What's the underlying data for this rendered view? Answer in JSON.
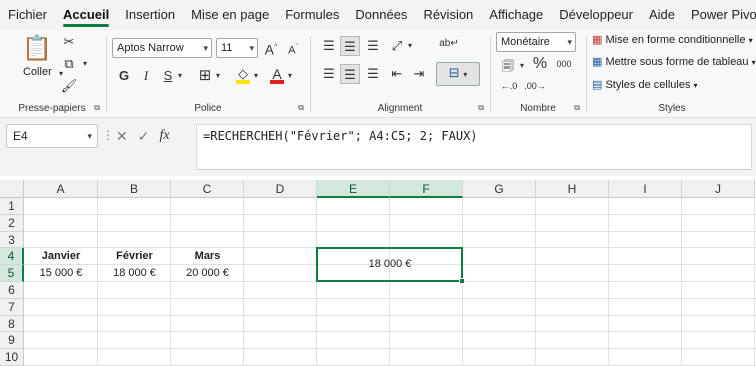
{
  "menu": {
    "tabs": [
      "Fichier",
      "Accueil",
      "Insertion",
      "Mise en page",
      "Formules",
      "Données",
      "Révision",
      "Affichage",
      "Développeur",
      "Aide",
      "Power Pivot"
    ],
    "active": "Accueil"
  },
  "ribbon": {
    "clipboard": {
      "paste_label": "Coller",
      "group_label": "Presse-papiers"
    },
    "font": {
      "name": "Aptos Narrow",
      "size": "11",
      "bold": "G",
      "italic": "I",
      "underline": "S",
      "grow": "A",
      "shrink": "A",
      "font_color_letter": "A",
      "group_label": "Police"
    },
    "alignment": {
      "group_label": "Alignment"
    },
    "number": {
      "format": "Monétaire",
      "percent": "%",
      "thousands": "000",
      "group_label": "Nombre"
    },
    "styles": {
      "conditional": "Mise en forme conditionnelle",
      "as_table": "Mettre sous forme de tableau",
      "cell_styles": "Styles de cellules",
      "group_label": "Styles"
    },
    "colors": {
      "accent": "#107c41",
      "fill_yellow": "#ffe600",
      "font_red": "#e01e1e"
    }
  },
  "formula_bar": {
    "name_box": "E4",
    "fx": "fx",
    "formula": "=RECHERCHEH(\"Février\"; A4:C5; 2; FAUX)"
  },
  "sheet": {
    "columns": [
      "A",
      "B",
      "C",
      "D",
      "E",
      "F",
      "G",
      "H",
      "I",
      "J"
    ],
    "rows": [
      "1",
      "2",
      "3",
      "4",
      "5",
      "6",
      "7",
      "8",
      "9",
      "10"
    ],
    "selected_columns": [
      "E",
      "F"
    ],
    "selected_rows": [
      "4",
      "5"
    ],
    "cells": {
      "A4": "Janvier",
      "B4": "Février",
      "C4": "Mars",
      "A5": "15 000 €",
      "B5": "18 000 €",
      "C5": "20 000 €",
      "E4": "18 000 €"
    }
  }
}
